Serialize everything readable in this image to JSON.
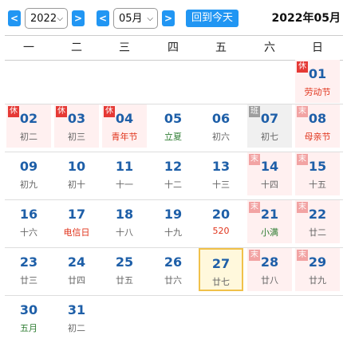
{
  "toolbar": {
    "prev_year": "<",
    "year": "2022",
    "next_year": ">",
    "prev_month": "<",
    "month": "05月",
    "next_month": ">",
    "today_label": "回到今天",
    "title": "2022年05月"
  },
  "weekdays": [
    "一",
    "二",
    "三",
    "四",
    "五",
    "六",
    "日"
  ],
  "badges": {
    "rest": "休",
    "work": "班",
    "weekend": "末"
  },
  "colors": {
    "accent": "#2196f3",
    "day": "#1e5fa8",
    "holiday_bg": "#fff0f0",
    "festival": "#e0341c",
    "term": "#2e7d32",
    "today_border": "#f0c14a"
  },
  "days": [
    {
      "d": "01",
      "sub": "劳动节",
      "subtype": "red",
      "badge": "rest",
      "bg": "hol"
    },
    {
      "d": "02",
      "sub": "初二",
      "subtype": "",
      "badge": "rest",
      "bg": "hol"
    },
    {
      "d": "03",
      "sub": "初三",
      "subtype": "",
      "badge": "rest",
      "bg": "hol"
    },
    {
      "d": "04",
      "sub": "青年节",
      "subtype": "red",
      "badge": "rest",
      "bg": "hol"
    },
    {
      "d": "05",
      "sub": "立夏",
      "subtype": "green",
      "badge": "",
      "bg": ""
    },
    {
      "d": "06",
      "sub": "初六",
      "subtype": "",
      "badge": "",
      "bg": ""
    },
    {
      "d": "07",
      "sub": "初七",
      "subtype": "",
      "badge": "work",
      "bg": "work"
    },
    {
      "d": "08",
      "sub": "母亲节",
      "subtype": "red",
      "badge": "weekend",
      "bg": "hol"
    },
    {
      "d": "09",
      "sub": "初九",
      "subtype": "",
      "badge": "",
      "bg": ""
    },
    {
      "d": "10",
      "sub": "初十",
      "subtype": "",
      "badge": "",
      "bg": ""
    },
    {
      "d": "11",
      "sub": "十一",
      "subtype": "",
      "badge": "",
      "bg": ""
    },
    {
      "d": "12",
      "sub": "十二",
      "subtype": "",
      "badge": "",
      "bg": ""
    },
    {
      "d": "13",
      "sub": "十三",
      "subtype": "",
      "badge": "",
      "bg": ""
    },
    {
      "d": "14",
      "sub": "十四",
      "subtype": "",
      "badge": "weekend",
      "bg": "hol"
    },
    {
      "d": "15",
      "sub": "十五",
      "subtype": "",
      "badge": "weekend",
      "bg": "hol"
    },
    {
      "d": "16",
      "sub": "十六",
      "subtype": "",
      "badge": "",
      "bg": ""
    },
    {
      "d": "17",
      "sub": "电信日",
      "subtype": "red",
      "badge": "",
      "bg": ""
    },
    {
      "d": "18",
      "sub": "十八",
      "subtype": "",
      "badge": "",
      "bg": ""
    },
    {
      "d": "19",
      "sub": "十九",
      "subtype": "",
      "badge": "",
      "bg": ""
    },
    {
      "d": "20",
      "sub": "520",
      "subtype": "red",
      "badge": "",
      "bg": ""
    },
    {
      "d": "21",
      "sub": "小满",
      "subtype": "green",
      "badge": "weekend",
      "bg": "hol"
    },
    {
      "d": "22",
      "sub": "廿二",
      "subtype": "",
      "badge": "weekend",
      "bg": "hol"
    },
    {
      "d": "23",
      "sub": "廿三",
      "subtype": "",
      "badge": "",
      "bg": ""
    },
    {
      "d": "24",
      "sub": "廿四",
      "subtype": "",
      "badge": "",
      "bg": ""
    },
    {
      "d": "25",
      "sub": "廿五",
      "subtype": "",
      "badge": "",
      "bg": ""
    },
    {
      "d": "26",
      "sub": "廿六",
      "subtype": "",
      "badge": "",
      "bg": ""
    },
    {
      "d": "27",
      "sub": "廿七",
      "subtype": "",
      "badge": "",
      "bg": "today"
    },
    {
      "d": "28",
      "sub": "廿八",
      "subtype": "",
      "badge": "weekend",
      "bg": "hol"
    },
    {
      "d": "29",
      "sub": "廿九",
      "subtype": "",
      "badge": "weekend",
      "bg": "hol"
    },
    {
      "d": "30",
      "sub": "五月",
      "subtype": "green",
      "badge": "",
      "bg": ""
    },
    {
      "d": "31",
      "sub": "初二",
      "subtype": "",
      "badge": "",
      "bg": ""
    }
  ]
}
